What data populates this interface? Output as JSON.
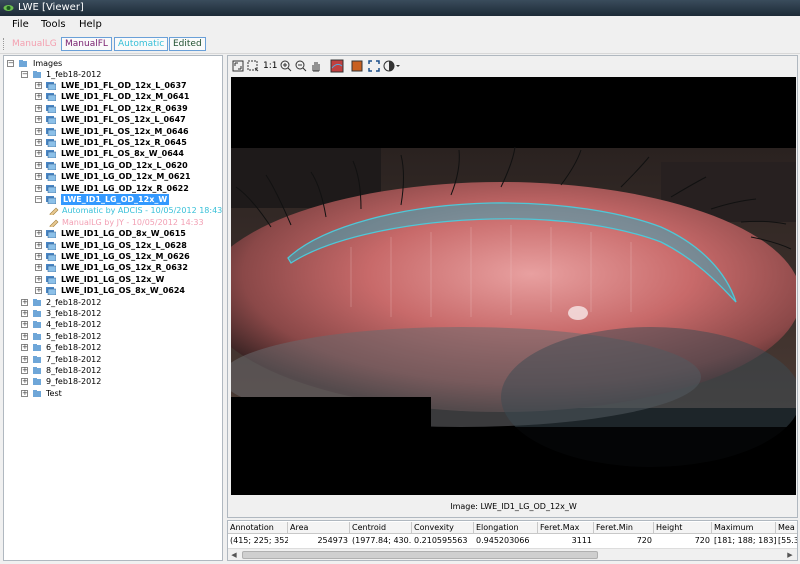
{
  "window": {
    "title": "LWE [Viewer]"
  },
  "menu": {
    "file": "File",
    "tools": "Tools",
    "help": "Help"
  },
  "modes": {
    "manual_lg": "ManualLG",
    "manual_fl": "ManualFL",
    "automatic": "Automatic",
    "edited": "Edited"
  },
  "tree": {
    "root": "Images",
    "group1": "1_feb18-2012",
    "items": [
      "LWE_ID1_FL_OD_12x_L_0637",
      "LWE_ID1_FL_OD_12x_M_0641",
      "LWE_ID1_FL_OD_12x_R_0639",
      "LWE_ID1_FL_OS_12x_L_0647",
      "LWE_ID1_FL_OS_12x_M_0646",
      "LWE_ID1_FL_OS_12x_R_0645",
      "LWE_ID1_FL_OS_8x_W_0644",
      "LWE_ID1_LG_OD_12x_L_0620",
      "LWE_ID1_LG_OD_12x_M_0621",
      "LWE_ID1_LG_OD_12x_R_0622"
    ],
    "selected": "LWE_ID1_LG_OD_12x_W",
    "annotation_auto": "Automatic by ADCIS - 10/05/2012 18:43",
    "annotation_manual": "ManualLG by JY - 10/05/2012 14:33",
    "items_after": [
      "LWE_ID1_LG_OD_8x_W_0615",
      "LWE_ID1_LG_OS_12x_L_0628",
      "LWE_ID1_LG_OS_12x_M_0626",
      "LWE_ID1_LG_OS_12x_R_0632",
      "LWE_ID1_LG_OS_12x_W",
      "LWE_ID1_LG_OS_8x_W_0624"
    ],
    "groups": [
      "2_feb18-2012",
      "3_feb18-2012",
      "4_feb18-2012",
      "5_feb18-2012",
      "6_feb18-2012",
      "7_feb18-2012",
      "8_feb18-2012",
      "9_feb18-2012",
      "Test"
    ]
  },
  "viewer": {
    "zoom_label": "1:1",
    "caption": "Image: LWE_ID1_LG_OD_12x_W"
  },
  "table": {
    "headers": [
      "Annotation",
      "Area",
      "Centroid",
      "Convexity",
      "Elongation",
      "Feret.Max",
      "Feret.Min",
      "Height",
      "Maximum",
      "Mea"
    ],
    "row": [
      "(415; 225; 352",
      "254973",
      "(1977.84; 430.",
      "0.210595563",
      "0.945203066",
      "3111",
      "720",
      "720",
      "[181; 188; 183]",
      "[55.3"
    ]
  },
  "colors": {
    "selection": "#3399ff",
    "auto_text": "#38c0d8",
    "manual_text": "#f2a0b4",
    "outline": "#4ec8d8"
  }
}
